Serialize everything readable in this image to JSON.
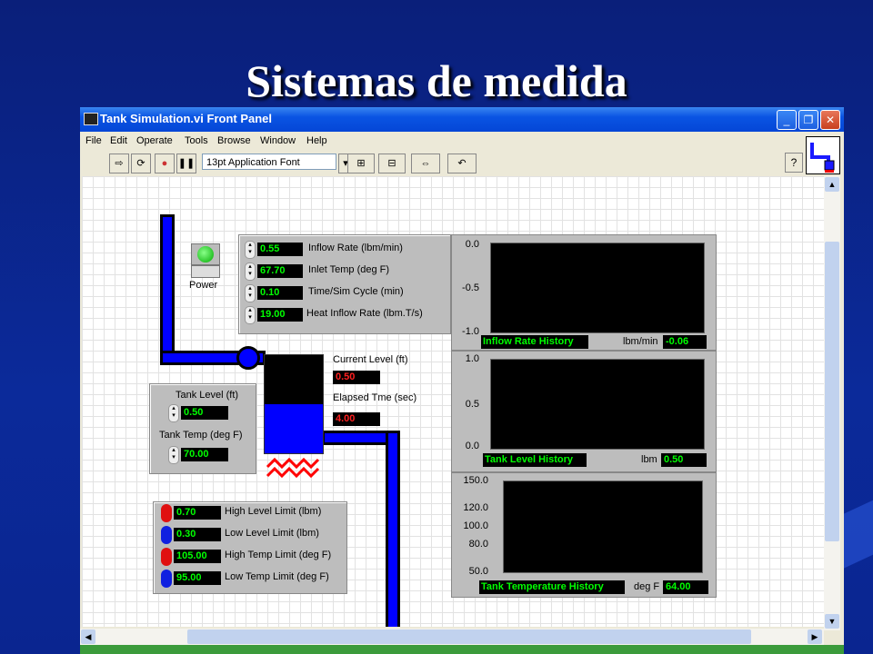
{
  "slide": {
    "title": "Sistemas de medida"
  },
  "window": {
    "title": "Tank Simulation.vi Front Panel",
    "buttons": [
      "_",
      "❐",
      "✕"
    ],
    "menu": [
      "File",
      "Edit",
      "Operate",
      "Tools",
      "Browse",
      "Window",
      "Help"
    ],
    "font_select": "13pt Application Font",
    "help_label": "?"
  },
  "controls": {
    "power_label": "Power",
    "inflow": [
      {
        "value": "0.55",
        "label": "Inflow Rate (lbm/min)"
      },
      {
        "value": "67.70",
        "label": "Inlet Temp (deg F)"
      },
      {
        "value": "0.10",
        "label": "Time/Sim Cycle (min)"
      },
      {
        "value": "19.00",
        "label": "Heat Inflow Rate (lbm.T/s)"
      }
    ],
    "tank_level_label": "Tank Level (ft)",
    "tank_level_value": "0.50",
    "tank_temp_label": "Tank Temp (deg F)",
    "tank_temp_value": "70.00",
    "current_level_label": "Current Level (ft)",
    "current_level_value": "0.50",
    "elapsed_label": "Elapsed Tme (sec)",
    "elapsed_value": "4.00",
    "limits": [
      {
        "value": "0.70",
        "label": "High Level Limit (lbm)",
        "color": "#e01010"
      },
      {
        "value": "0.30",
        "label": "Low Level Limit (lbm)",
        "color": "#1020e0"
      },
      {
        "value": "105.00",
        "label": "High Temp Limit (deg F)",
        "color": "#e01010"
      },
      {
        "value": "95.00",
        "label": "Low Temp Limit (deg F)",
        "color": "#1020e0"
      }
    ]
  },
  "charts": [
    {
      "name": "Inflow Rate History",
      "unit": "lbm/min",
      "readout": "-0.06",
      "ticks": [
        "0.0",
        "-0.5",
        "-1.0"
      ]
    },
    {
      "name": "Tank Level History",
      "unit": "lbm",
      "readout": "0.50",
      "ticks": [
        "1.0",
        "0.5",
        "0.0"
      ]
    },
    {
      "name": "Tank Temperature History",
      "unit": "deg F",
      "readout": "64.00",
      "ticks": [
        "150.0",
        "120.0",
        "100.0",
        "80.0",
        "50.0"
      ]
    }
  ]
}
